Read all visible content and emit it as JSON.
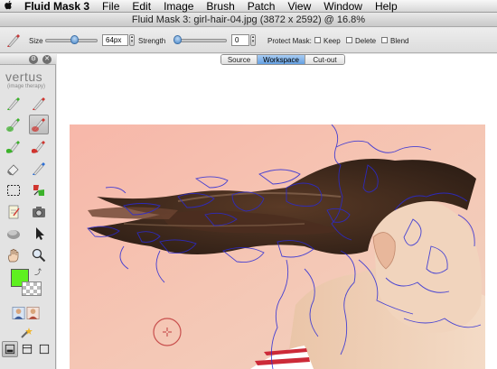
{
  "menubar": {
    "apple": "",
    "items": [
      "Fluid Mask 3",
      "File",
      "Edit",
      "Image",
      "Brush",
      "Patch",
      "View",
      "Window",
      "Help"
    ]
  },
  "window": {
    "title": "Fluid Mask 3: girl-hair-04.jpg (3872 x 2592) @ 16.8%"
  },
  "toolbar": {
    "size_label": "Size",
    "size_value": "64px",
    "size_level": 0.55,
    "strength_label": "Strength",
    "strength_value": "0",
    "strength_level": 0.05,
    "protect_mask_label": "Protect Mask:",
    "keep_label": "Keep",
    "delete_label": "Delete",
    "blend_label": "Blend"
  },
  "leftpanel": {
    "logo": "vertus",
    "logo_sub": "(image therapy)",
    "foreground_color": "#5ef01f"
  },
  "view_tabs": {
    "source": "Source",
    "workspace": "Workspace",
    "cutout": "Cut-out",
    "active": "Workspace"
  },
  "colors": {
    "accent": "#5c9be0",
    "segment_lines": "#2a2ad6",
    "cursor": "#c0393b"
  }
}
